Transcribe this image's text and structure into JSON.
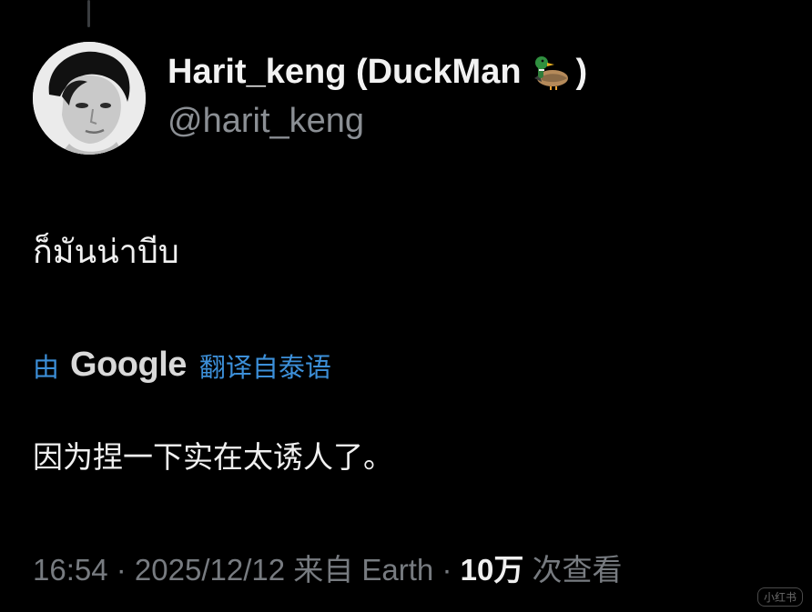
{
  "author": {
    "display_name": "Harit_keng (DuckMan",
    "display_name_end": ")",
    "emoji_icon": "duck-icon",
    "handle": "@harit_keng"
  },
  "tweet": {
    "text": "ก็มันน่าบีบ"
  },
  "translation": {
    "prefix": "由",
    "brand": "Google",
    "suffix": "翻译自泰语",
    "text": "因为捏一下实在太诱人了。",
    "accent_color": "#3c8fd8"
  },
  "meta": {
    "time_date": "16:54 · 2025/12/12 来自 Earth ·",
    "views_count": "10万",
    "views_label": "次查看"
  },
  "watermark": {
    "text": "小红书"
  }
}
